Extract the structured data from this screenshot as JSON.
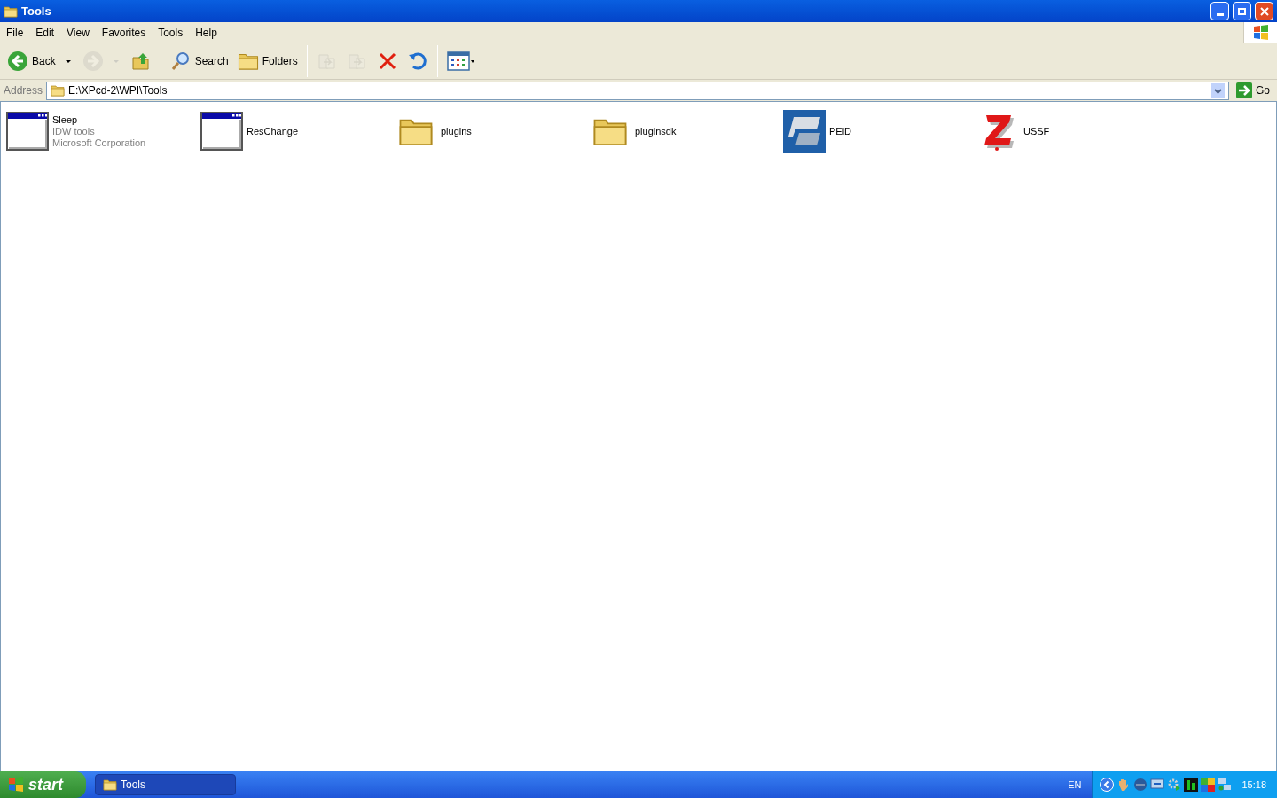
{
  "window": {
    "title": "Tools"
  },
  "menu": [
    "File",
    "Edit",
    "View",
    "Favorites",
    "Tools",
    "Help"
  ],
  "toolbar": [
    {
      "kind": "back",
      "label": "Back",
      "disabled": false
    },
    {
      "kind": "forward",
      "disabled": true
    },
    {
      "kind": "up",
      "disabled": false
    },
    {
      "kind": "search",
      "label": "Search",
      "disabled": false
    },
    {
      "kind": "folders",
      "label": "Folders",
      "disabled": false
    },
    {
      "kind": "move",
      "disabled": true
    },
    {
      "kind": "copy",
      "disabled": true
    },
    {
      "kind": "delete",
      "disabled": false
    },
    {
      "kind": "undo",
      "disabled": false
    },
    {
      "kind": "views",
      "disabled": false
    }
  ],
  "address": {
    "label": "Address",
    "value": "E:\\XPcd-2\\WPI\\Tools",
    "go": "Go"
  },
  "files": [
    {
      "kind": "app",
      "name": "Sleep",
      "details": [
        "IDW tools",
        "Microsoft Corporation"
      ]
    },
    {
      "kind": "app",
      "name": "ResChange"
    },
    {
      "kind": "folder",
      "name": "plugins"
    },
    {
      "kind": "folder",
      "name": "pluginsdk"
    },
    {
      "kind": "peid",
      "name": "PEiD"
    },
    {
      "kind": "ussf",
      "name": "USSF"
    }
  ],
  "taskbar": {
    "start": "start",
    "tasks": [
      {
        "label": "Tools",
        "selected": true
      }
    ],
    "language": "EN",
    "clock": "15:18"
  }
}
